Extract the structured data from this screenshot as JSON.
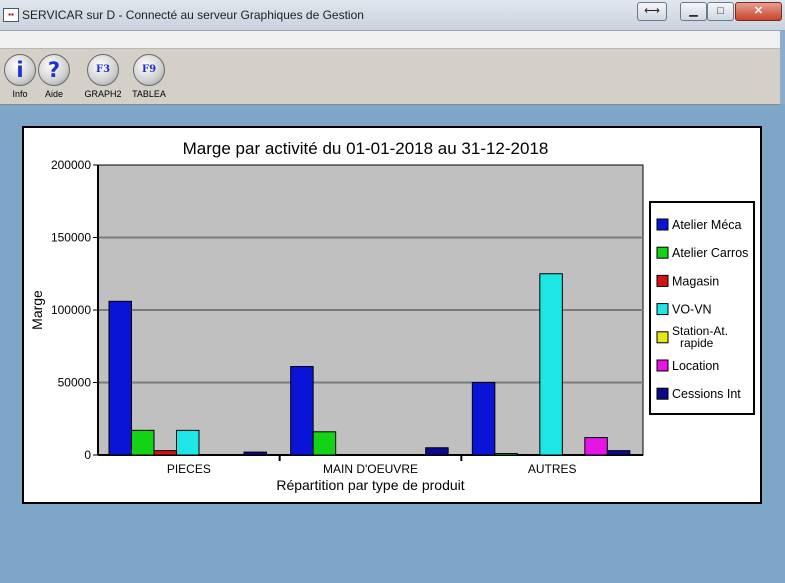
{
  "window": {
    "title": "SERVICAR sur D - Connecté au serveur Graphiques de Gestion",
    "app_icon": "servicar-app-icon"
  },
  "toolbar": {
    "buttons": [
      {
        "label": "Info",
        "glyph": "i",
        "icon": "info-icon"
      },
      {
        "label": "Aide",
        "glyph": "?",
        "icon": "help-icon"
      },
      {
        "label": "GRAPH2",
        "glyph": "F3",
        "icon": "f3-key-icon"
      },
      {
        "label": "TABLEA",
        "glyph": "F9",
        "icon": "f9-key-icon"
      }
    ]
  },
  "colors": {
    "desktop": "#7ea6c8",
    "plot_bg": "#c0c0c0",
    "gridline": "#7a7a7a"
  },
  "chart_data": {
    "type": "bar",
    "title": "Marge par activité du 01-01-2018 au 31-12-2018",
    "xlabel": "Répartition par type de produit",
    "ylabel": "Marge",
    "ylim": [
      0,
      200000
    ],
    "yticks": [
      0,
      50000,
      100000,
      150000,
      200000
    ],
    "ytick_labels": [
      "0",
      "50000",
      "100000",
      "150000",
      "200000"
    ],
    "grid": true,
    "legend_position": "right",
    "categories": [
      "PIECES",
      "MAIN D'OEUVRE",
      "AUTRES"
    ],
    "series": [
      {
        "name": "Atelier Méca",
        "color": "#0a14d6",
        "values": [
          106000,
          61000,
          50000
        ]
      },
      {
        "name": "Atelier Carros",
        "color": "#14d214",
        "values": [
          17000,
          16000,
          1000
        ]
      },
      {
        "name": "Magasin",
        "color": "#d21414",
        "values": [
          3000,
          0,
          0
        ]
      },
      {
        "name": "VO-VN",
        "color": "#1ee6e6",
        "values": [
          17000,
          0,
          125000
        ]
      },
      {
        "name": "Station-At. rapide",
        "color": "#e6e614",
        "values": [
          0,
          0,
          0
        ]
      },
      {
        "name": "Location",
        "color": "#e614e6",
        "values": [
          0,
          0,
          12000
        ]
      },
      {
        "name": "Cessions Int",
        "color": "#0a0a8c",
        "values": [
          2000,
          5000,
          3000
        ]
      }
    ]
  }
}
